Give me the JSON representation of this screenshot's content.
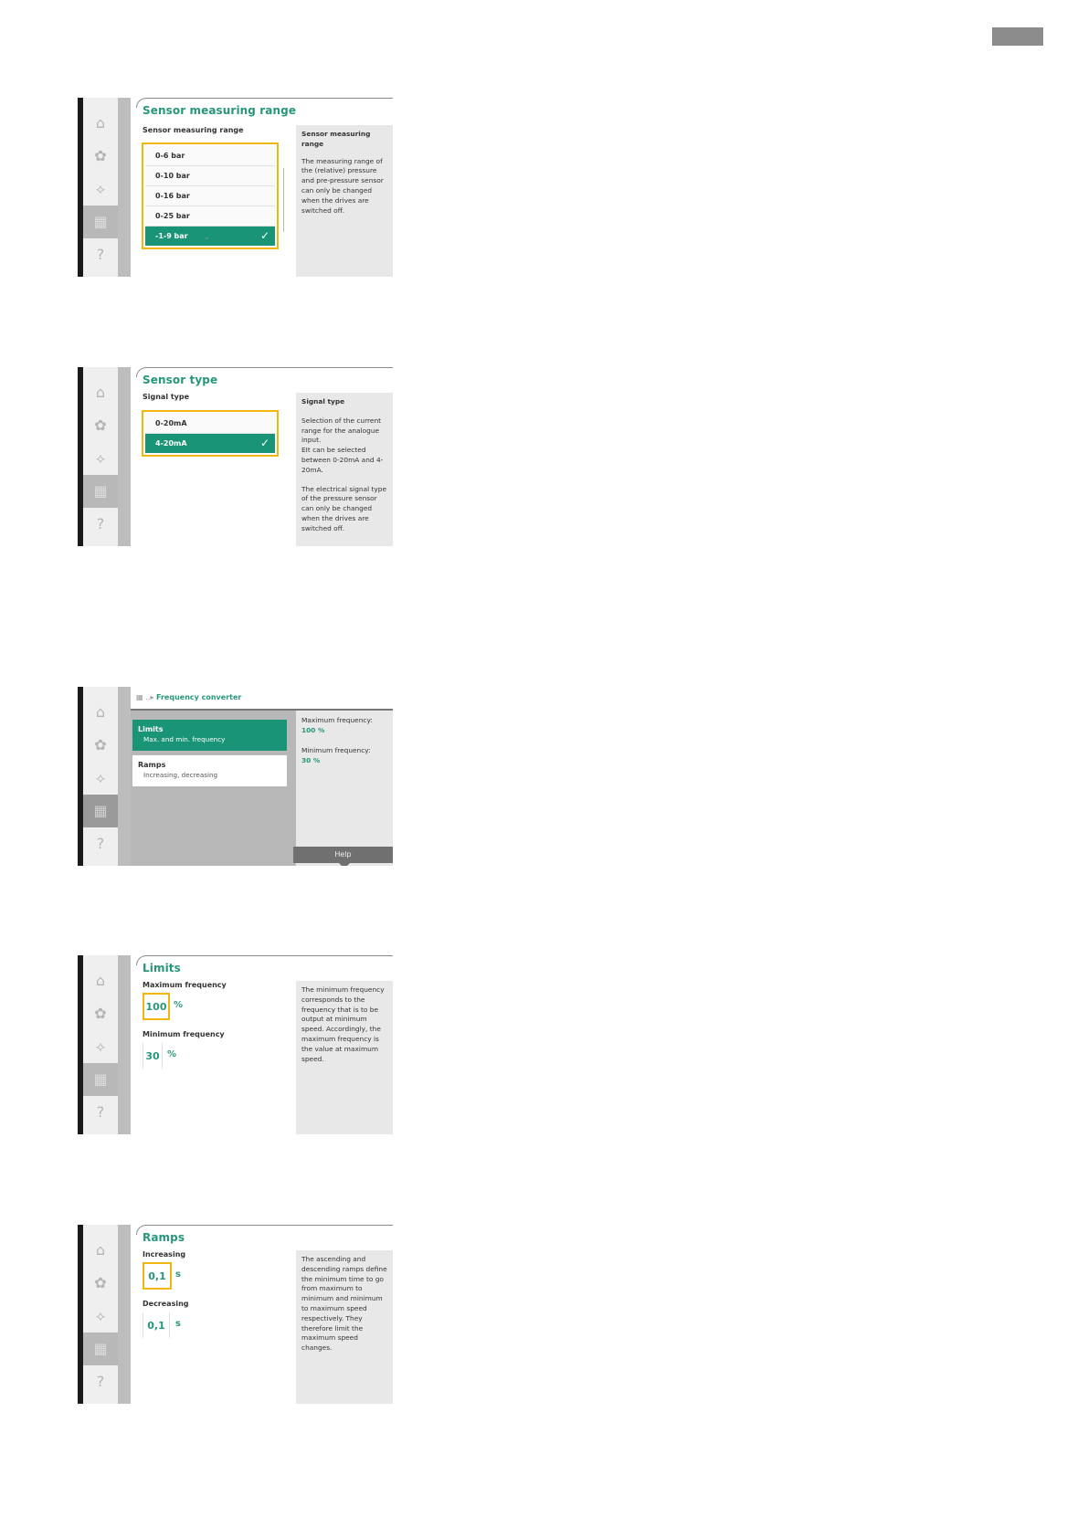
{
  "icons": {
    "home": "⌂",
    "settings": "✿",
    "diagnostics": "⟡",
    "system": "▦",
    "help": "?",
    "check": "✓",
    "scroll_down": "⌄",
    "breadcrumb_icon": "▦",
    "breadcrumb_sep": " ‥▸ "
  },
  "colors": {
    "accent": "#1a9476",
    "focus": "#f2b70f",
    "help_bg": "#e8e8e8"
  },
  "screen1": {
    "title": "Sensor measuring range",
    "subtitle": "Sensor measuring range",
    "options": [
      "0-6 bar",
      "0-10 bar",
      "0-16 bar",
      "0-25 bar",
      "-1-9 bar"
    ],
    "selected_option": "-1-9 bar",
    "help_heading": "Sensor measuring range",
    "help_text": "The measuring range of the (relative) pressure and pre-pressure sensor can only be changed when the drives are switched off."
  },
  "screen2": {
    "title": "Sensor type",
    "subtitle": "Signal type",
    "options": [
      "0-20mA",
      "4-20mA"
    ],
    "selected_option": "4-20mA",
    "help_heading": "Signal type",
    "help_text_1": "Selection of the current range for the analogue input.",
    "help_text_2": "EIt can be selected between 0-20mA and 4-20mA.",
    "help_text_3": "The electrical signal type of the pressure sensor can only be changed when the drives are switched off."
  },
  "screen3": {
    "breadcrumb": "Frequency converter",
    "menu": [
      {
        "label": "Limits",
        "desc": "Max. and min. frequency"
      },
      {
        "label": "Ramps",
        "desc": "Increasing, decreasing"
      }
    ],
    "overview": [
      {
        "label": "Maximum frequency:",
        "value": "100 %"
      },
      {
        "label": "Minimum frequency:",
        "value": "30 %"
      }
    ],
    "help_button": "Help"
  },
  "screen4": {
    "title": "Limits",
    "max_label": "Maximum frequency",
    "max_value": "100",
    "min_label": "Minimum frequency",
    "min_value": "30",
    "unit": "%",
    "help_text": "The minimum frequency corresponds to the frequency that is to be output at minimum speed. Accordingly, the maximum frequency is the value at maximum speed."
  },
  "screen5": {
    "title": "Ramps",
    "inc_label": "Increasing",
    "inc_value": "0,1",
    "dec_label": "Decreasing",
    "dec_value": "0,1",
    "unit": "s",
    "help_text": "The ascending and descending ramps define the minimum time to go from maximum to minimum and minimum to maximum speed respectively. They therefore limit the maximum speed changes."
  }
}
